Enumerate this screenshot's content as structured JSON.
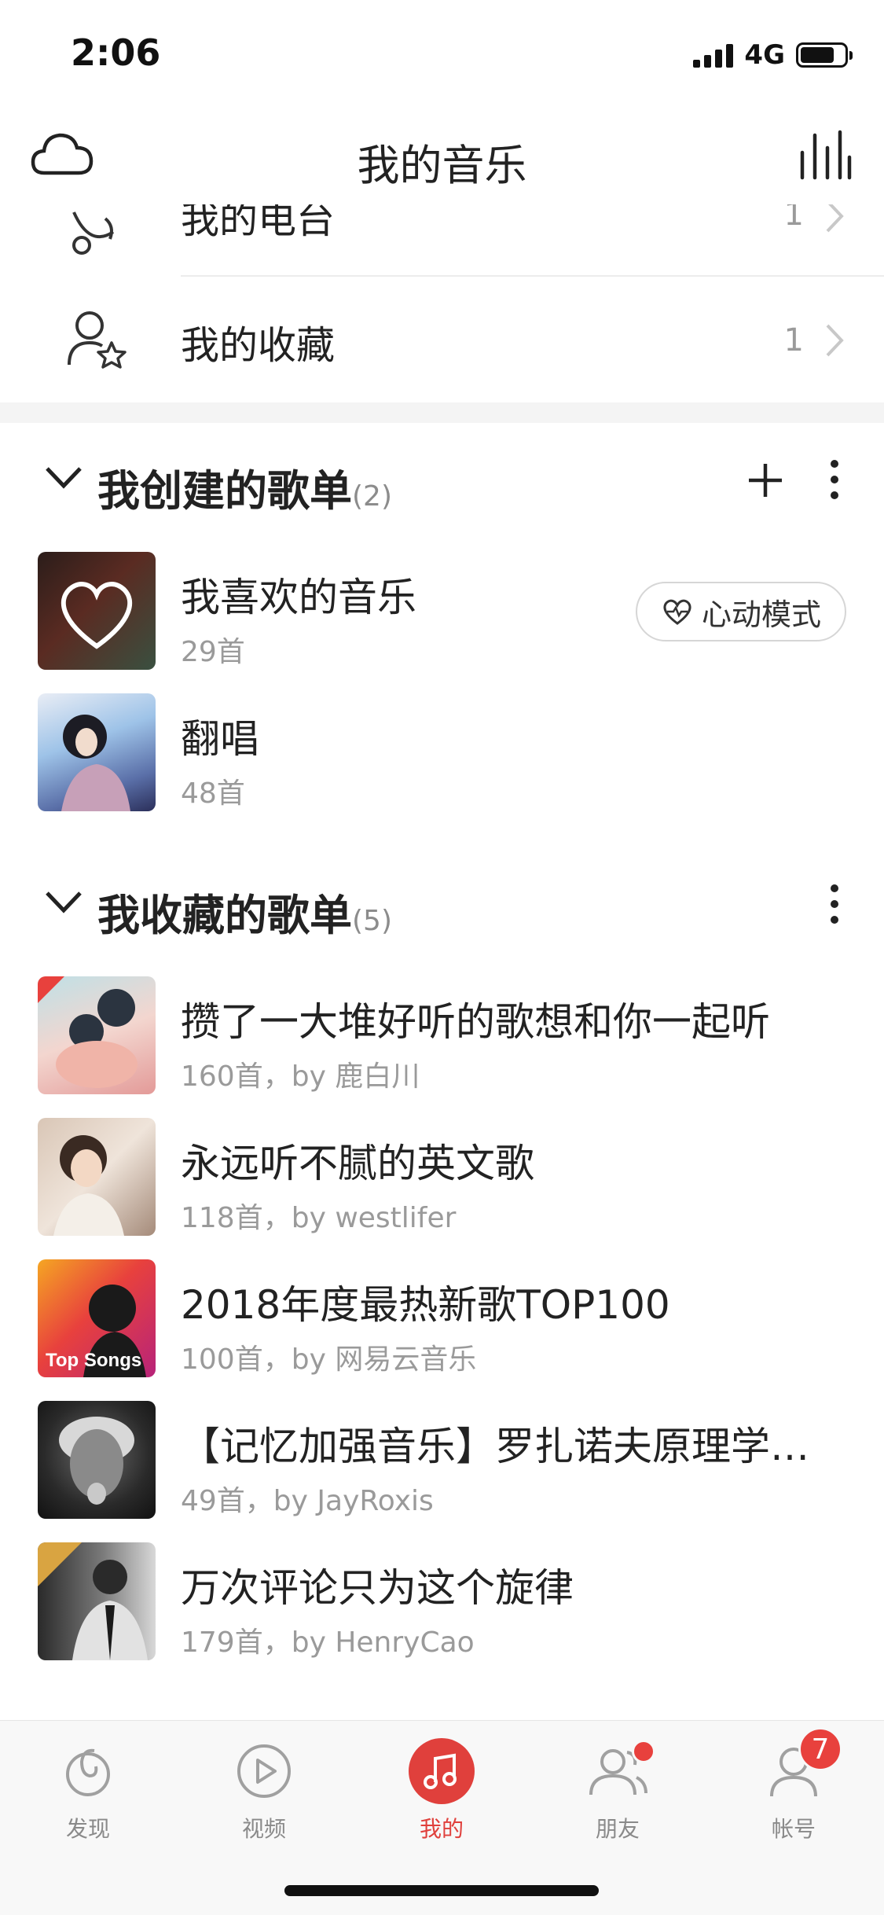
{
  "status": {
    "time": "2:06",
    "network": "4G"
  },
  "header": {
    "title": "我的音乐",
    "left_icon": "cloud-icon",
    "right_icon": "equalizer-icon"
  },
  "top_rows": [
    {
      "label": "我的电台",
      "count": "1",
      "icon": "radio-icon"
    },
    {
      "label": "我的收藏",
      "count": "1",
      "icon": "user-star-icon"
    }
  ],
  "created": {
    "title": "我创建的歌单",
    "count": "(2)",
    "playlists": [
      {
        "name": "我喜欢的音乐",
        "sub": "29首",
        "action": "心动模式"
      },
      {
        "name": "翻唱",
        "sub": "48首"
      }
    ]
  },
  "collected": {
    "title": "我收藏的歌单",
    "count": "(5)",
    "playlists": [
      {
        "name": "攒了一大堆好听的歌想和你一起听",
        "sub": "160首，by 鹿白川"
      },
      {
        "name": "永远听不腻的英文歌",
        "sub": "118首，by westlifer"
      },
      {
        "name": "2018年度最热新歌TOP100",
        "sub": "100首，by 网易云音乐",
        "cover_text": "Top Songs"
      },
      {
        "name": "【记忆加强音乐】罗扎诺夫原理学习法",
        "sub": "49首，by JayRoxis"
      },
      {
        "name": "万次评论只为这个旋律",
        "sub": "179首，by HenryCao"
      }
    ]
  },
  "tabs": [
    {
      "label": "发现",
      "icon": "discover-icon"
    },
    {
      "label": "视频",
      "icon": "video-icon"
    },
    {
      "label": "我的",
      "icon": "music-note-icon",
      "active": true
    },
    {
      "label": "朋友",
      "icon": "friends-icon",
      "dot": true
    },
    {
      "label": "帐号",
      "icon": "account-icon",
      "badge": "7"
    }
  ],
  "colors": {
    "accent": "#e0403c",
    "text": "#222222",
    "secondary": "#9a9a9a"
  }
}
